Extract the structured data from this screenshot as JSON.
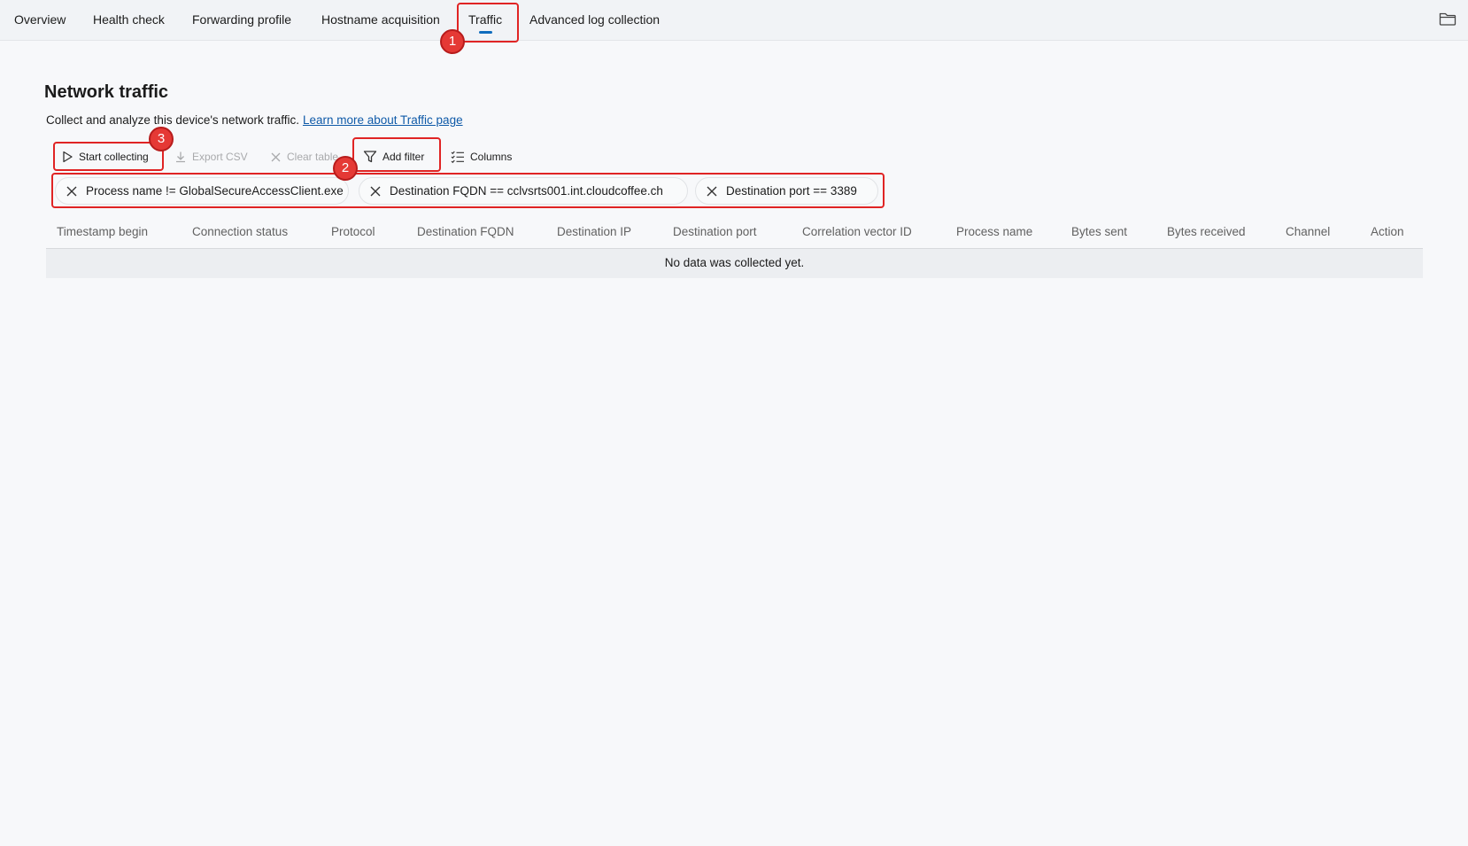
{
  "nav": {
    "tabs": [
      {
        "label": "Overview"
      },
      {
        "label": "Health check"
      },
      {
        "label": "Forwarding profile"
      },
      {
        "label": "Hostname acquisition"
      },
      {
        "label": "Traffic",
        "selected": true
      },
      {
        "label": "Advanced log collection"
      }
    ],
    "folder_icon": "folder-icon"
  },
  "page": {
    "title": "Network traffic",
    "description": "Collect and analyze this device's network traffic.",
    "link": "Learn more about Traffic page"
  },
  "toolbar": {
    "start_collecting": "Start collecting",
    "export_csv": "Export CSV",
    "clear_table": "Clear table",
    "add_filter": "Add filter",
    "columns": "Columns"
  },
  "filters": [
    "Process name != GlobalSecureAccessClient.exe",
    "Destination FQDN == cclvsrts001.int.cloudcoffee.ch",
    "Destination port == 3389"
  ],
  "table": {
    "columns": [
      "Timestamp begin",
      "Connection status",
      "Protocol",
      "Destination FQDN",
      "Destination IP",
      "Destination port",
      "Correlation vector ID",
      "Process name",
      "Bytes sent",
      "Bytes received",
      "Channel",
      "Action"
    ],
    "empty_message": "No data was collected yet."
  },
  "annotations": [
    "1",
    "2",
    "3"
  ],
  "colors": {
    "accent": "#0f6cbd",
    "annotation": "#e02424"
  }
}
